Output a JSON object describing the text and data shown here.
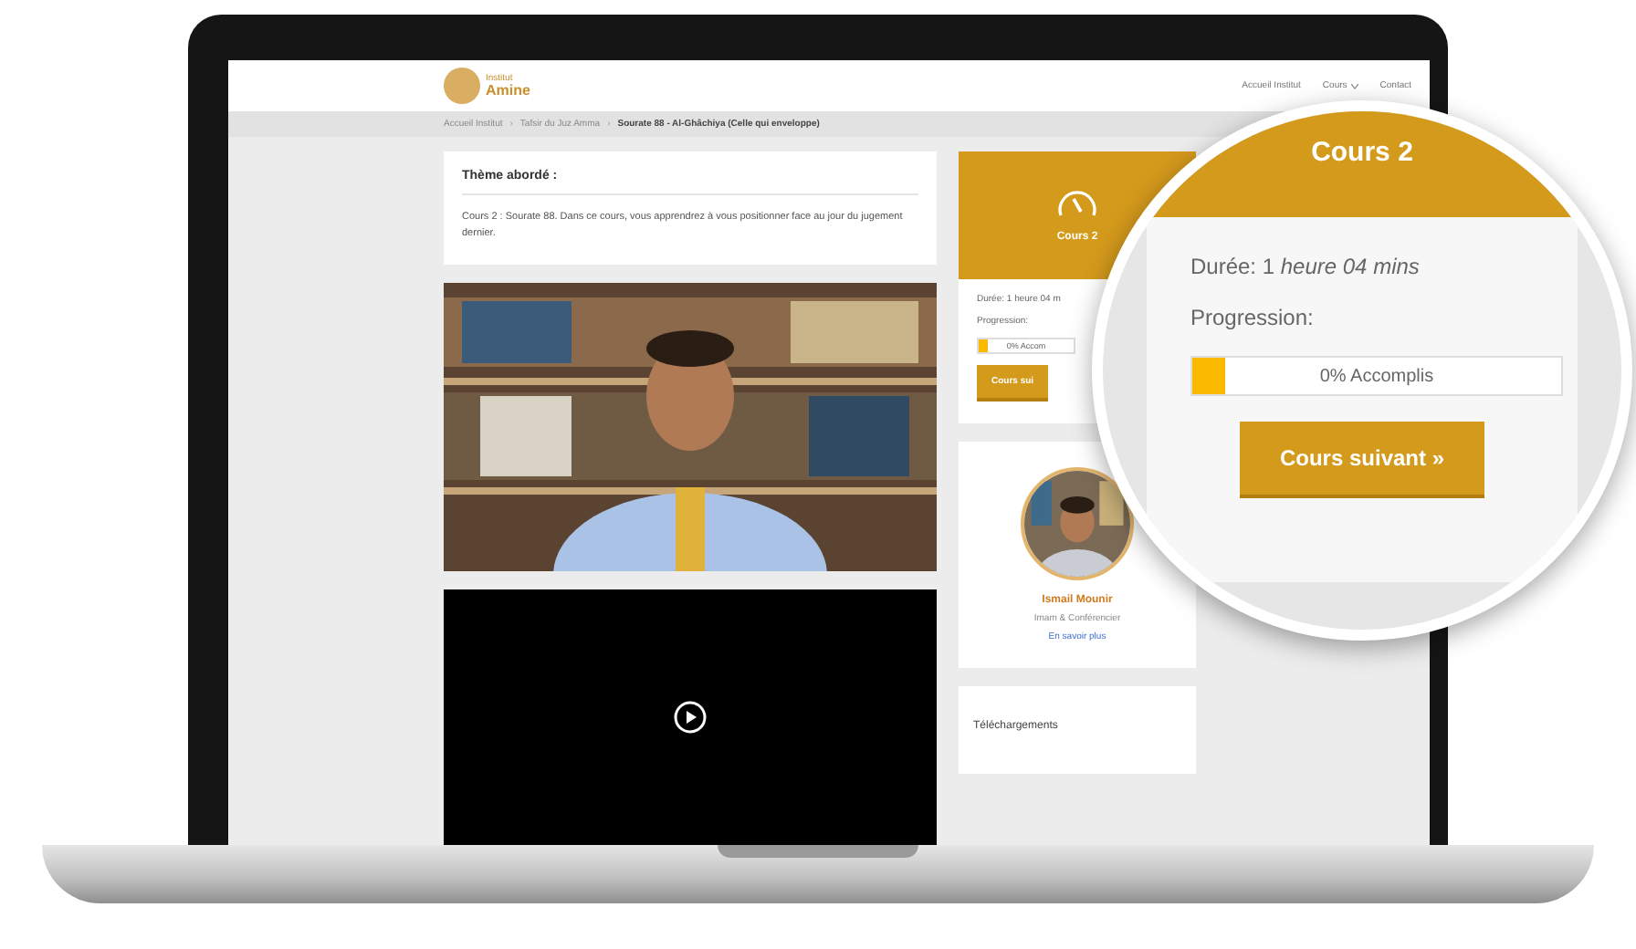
{
  "site": {
    "logo": {
      "line1": "Institut",
      "line2": "Amine"
    },
    "nav": [
      {
        "label": "Accueil Institut",
        "dropdown": false
      },
      {
        "label": "Cours",
        "dropdown": true
      },
      {
        "label": "Contact",
        "dropdown": false
      }
    ]
  },
  "breadcrumb_separator": "›",
  "breadcrumb": [
    {
      "label": "Accueil Institut",
      "current": false
    },
    {
      "label": "Tafsir du Juz Amma",
      "current": false
    },
    {
      "label": "Sourate 88 - Al-Ghâchiya (Celle qui enveloppe)",
      "current": true
    }
  ],
  "theme": {
    "title": "Thème abordé :",
    "text": "Cours 2 : Sourate 88. Dans ce cours, vous apprendrez à vous positionner face au jour du jugement dernier."
  },
  "video": {
    "kind": "video"
  },
  "course_card": {
    "title": "Cours 2",
    "duration": "Durée: 1 heure 04 m",
    "progress_label": "Progression:",
    "level": 0.09,
    "progress_text": "0% Accom",
    "button": "Cours sui"
  },
  "teacher": {
    "name": "Ismail Mounir",
    "role": "Imam & Conférencier",
    "link": "En savoir plus"
  },
  "downloads": {
    "title": "Téléchargements"
  },
  "magnifier": {
    "title": "Cours 2",
    "duration": "Durée: 1 *heure 04 mins*",
    "progress_label": "Progression:",
    "level": 0.09,
    "progress_text": "0% Accomplis",
    "button": "Cours suivant »"
  }
}
